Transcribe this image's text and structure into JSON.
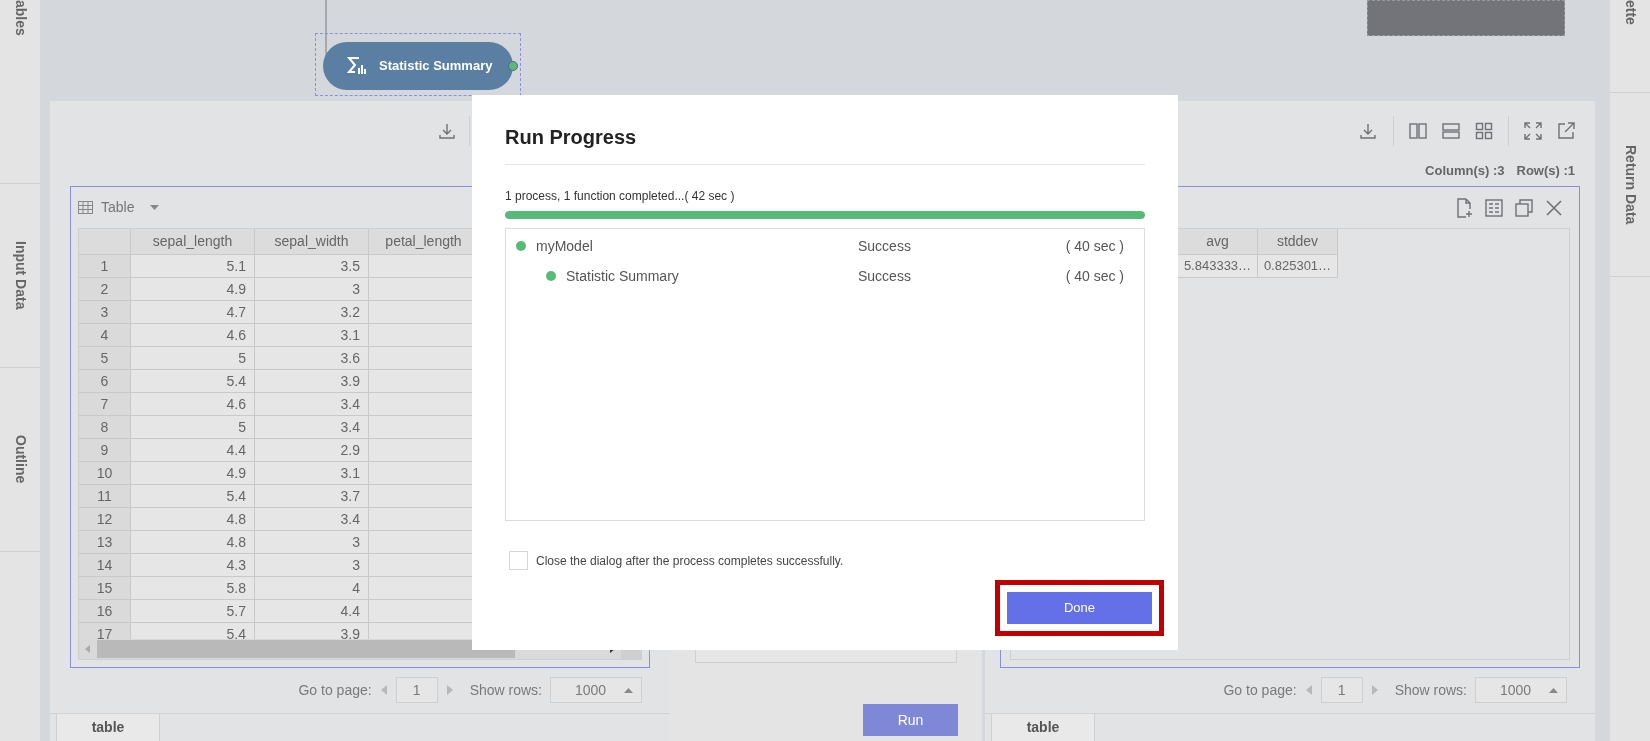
{
  "left_sidebar": [
    {
      "label": "ables"
    },
    {
      "label": "Input Data"
    },
    {
      "label": "Outline"
    }
  ],
  "right_sidebar": [
    {
      "label": "ette"
    },
    {
      "label": "Return Data"
    }
  ],
  "canvas": {
    "node": {
      "label": "Statistic Summary",
      "selected": true
    }
  },
  "input_panel": {
    "view": "Table",
    "columns": [
      "sepal_length",
      "sepal_width",
      "petal_length"
    ],
    "rows": [
      [
        "1",
        "5.1",
        "3.5"
      ],
      [
        "2",
        "4.9",
        "3"
      ],
      [
        "3",
        "4.7",
        "3.2"
      ],
      [
        "4",
        "4.6",
        "3.1"
      ],
      [
        "5",
        "5",
        "3.6"
      ],
      [
        "6",
        "5.4",
        "3.9"
      ],
      [
        "7",
        "4.6",
        "3.4"
      ],
      [
        "8",
        "5",
        "3.4"
      ],
      [
        "9",
        "4.4",
        "2.9"
      ],
      [
        "10",
        "4.9",
        "3.1"
      ],
      [
        "11",
        "5.4",
        "3.7"
      ],
      [
        "12",
        "4.8",
        "3.4"
      ],
      [
        "13",
        "4.8",
        "3"
      ],
      [
        "14",
        "4.3",
        "3"
      ],
      [
        "15",
        "5.8",
        "4"
      ],
      [
        "16",
        "5.7",
        "4.4"
      ],
      [
        "17",
        "5.4",
        "3.9"
      ]
    ],
    "pagination": {
      "go_label": "Go to page:",
      "page": "1",
      "rows_label": "Show rows:",
      "rows_value": "1000"
    },
    "tab": "table"
  },
  "middle_panel": {
    "run_button": "Run"
  },
  "result_panel": {
    "summary": [
      "Column(s) :3",
      "Row(s) :1"
    ],
    "columns": [
      "avg",
      "stddev"
    ],
    "rows": [
      [
        "5.843333…",
        "0.825301…"
      ]
    ],
    "pagination": {
      "go_label": "Go to page:",
      "page": "1",
      "rows_label": "Show rows:",
      "rows_value": "1000"
    },
    "tab": "table"
  },
  "dialog": {
    "title": "Run Progress",
    "progress_text": "1 process, 1 function completed...( 42 sec )",
    "level": 1,
    "items": [
      {
        "name": "myModel",
        "status": "Success",
        "time": "( 40 sec )",
        "color": "#55bb76",
        "children": [
          {
            "name": "Statistic Summary",
            "status": "Success",
            "time": "( 40 sec )",
            "color": "#55bb76"
          }
        ]
      }
    ],
    "auto_close": {
      "label": "Close the dialog after the process completes successfully.",
      "checked": false
    },
    "done_button": {
      "label": "Done",
      "highlighted": true
    }
  }
}
